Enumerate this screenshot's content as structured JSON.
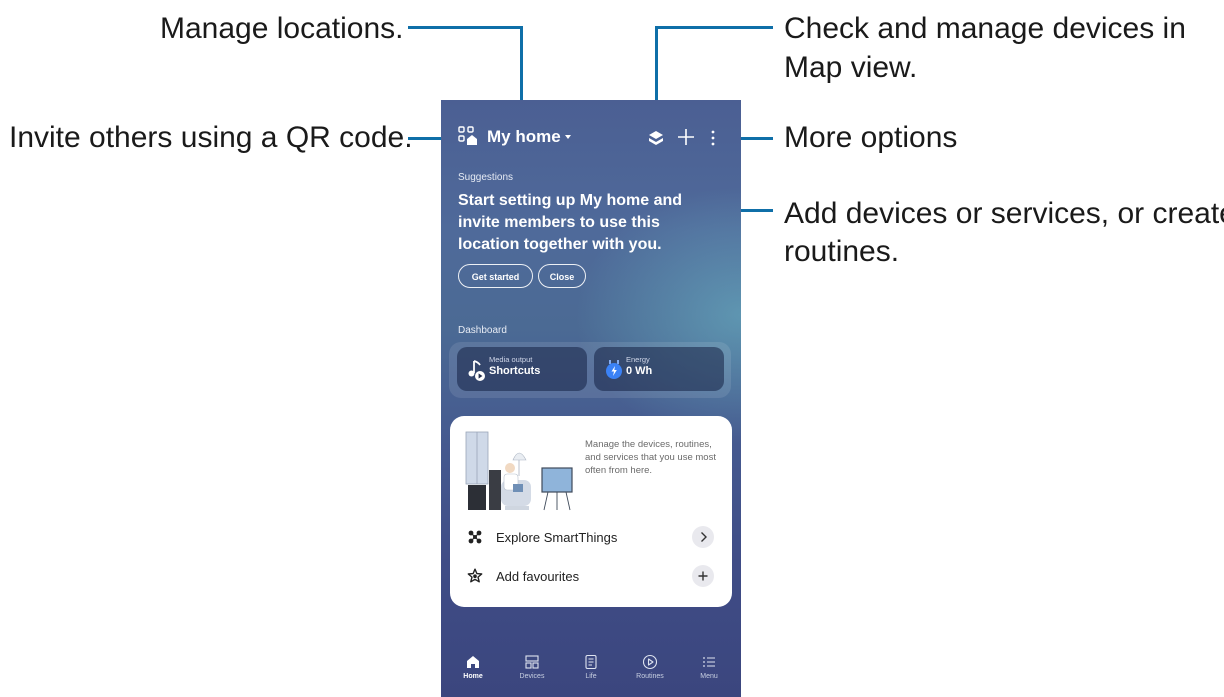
{
  "annotations": {
    "manage_locations": "Manage locations.",
    "invite_qr": "Invite others using a QR code.",
    "map_view_line1": "Check and manage devices in",
    "map_view_line2": "Map view.",
    "more_options": "More options",
    "add_devices_line1": "Add devices or services, or create",
    "add_devices_line2": "routines."
  },
  "header": {
    "location": "My home",
    "icons": [
      "qr-code-home-icon",
      "map-view-icon",
      "add-icon",
      "more-options-icon"
    ]
  },
  "suggestions": {
    "label": "Suggestions",
    "text": "Start setting up My home and invite members to use this location together with you.",
    "get_started": "Get started",
    "close": "Close"
  },
  "dashboard": {
    "label": "Dashboard",
    "media": {
      "sub": "Media output",
      "main": "Shortcuts",
      "icon": "media-output-icon"
    },
    "energy": {
      "sub": "Energy",
      "main": "0 Wh",
      "icon": "energy-icon"
    }
  },
  "card": {
    "description": "Manage the devices, routines, and services that you use most often from here.",
    "explore": {
      "label": "Explore SmartThings",
      "icon": "smartthings-icon"
    },
    "favourites": {
      "label": "Add favourites",
      "icon": "star-icon"
    }
  },
  "bottom_nav": [
    {
      "label": "Home",
      "icon": "home-icon",
      "active": true
    },
    {
      "label": "Devices",
      "icon": "devices-icon",
      "active": false
    },
    {
      "label": "Life",
      "icon": "life-icon",
      "active": false
    },
    {
      "label": "Routines",
      "icon": "routines-icon",
      "active": false
    },
    {
      "label": "Menu",
      "icon": "menu-icon",
      "active": false
    }
  ],
  "colors": {
    "leader_line": "#0f6fa8",
    "accent_blue": "#3b82f6"
  }
}
